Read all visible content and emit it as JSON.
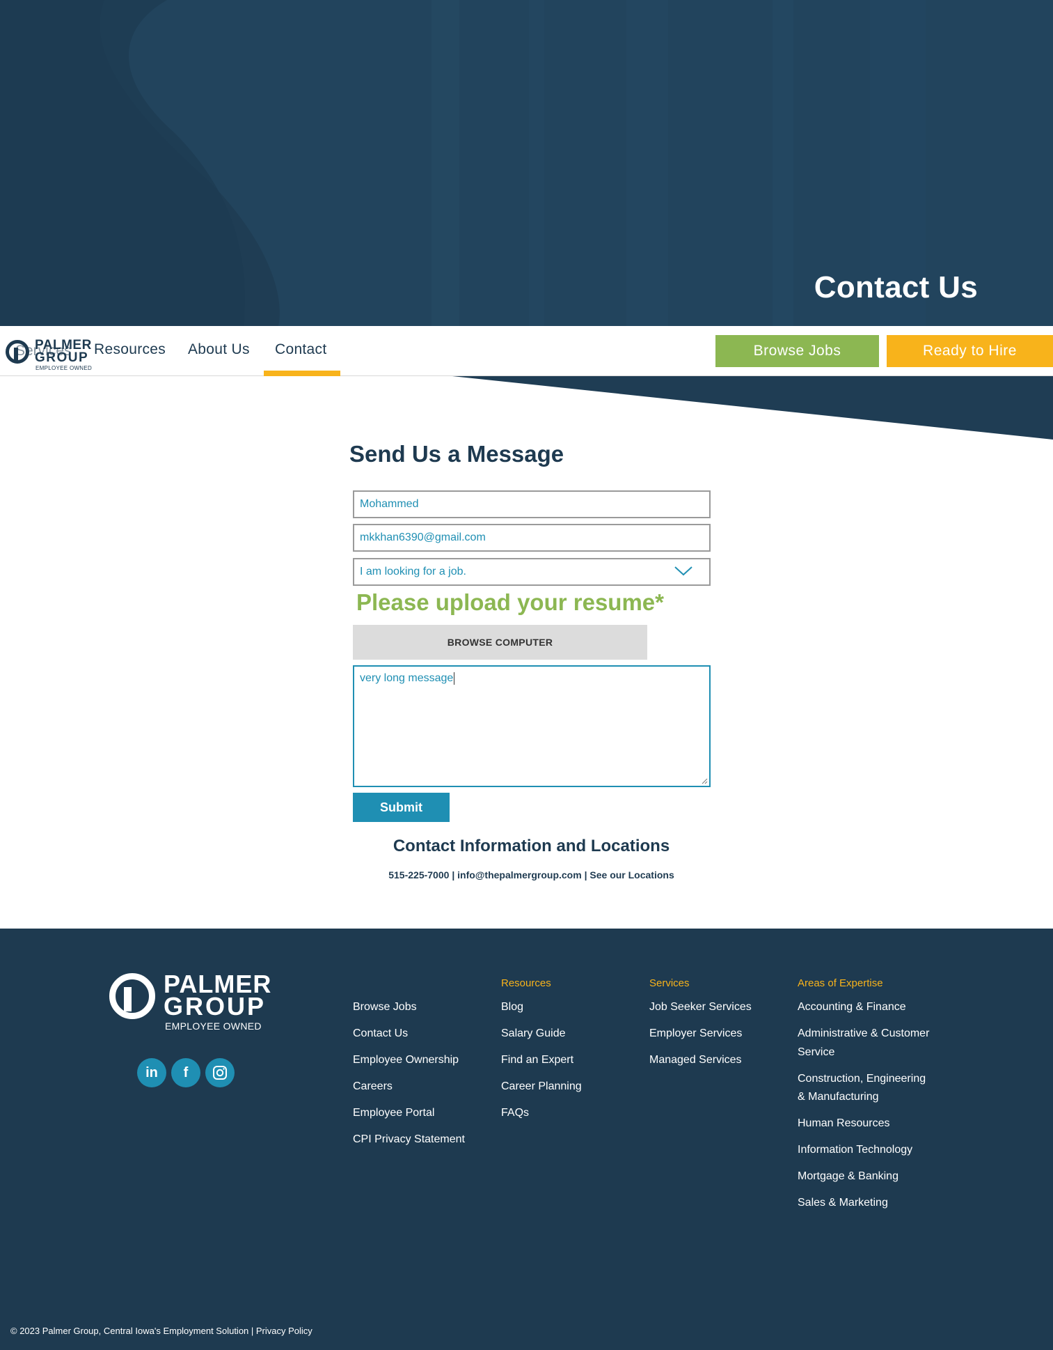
{
  "hero": {
    "title": "Contact Us"
  },
  "nav": {
    "logo": {
      "line1": "PALMER",
      "line2": "GROUP",
      "line3": "EMPLOYEE OWNED"
    },
    "underlay_label": "Services",
    "items": [
      {
        "label": "Resources"
      },
      {
        "label": "About Us"
      },
      {
        "label": "Contact",
        "active": true
      }
    ],
    "browse_jobs": "Browse Jobs",
    "ready_to_hire": "Ready to Hire"
  },
  "form": {
    "title": "Send Us a Message",
    "name_value": "Mohammed",
    "email_value": "mkkhan6390@gmail.com",
    "inquiry_selected": "I am looking for a job.",
    "upload_label": "Please upload your resume*",
    "upload_button": "BROWSE COMPUTER",
    "message_value": "very long message",
    "submit": "Submit"
  },
  "contact": {
    "heading": "Contact Information and Locations",
    "phone": "515-225-7000",
    "email": "info@thepalmergroup.com",
    "locations": "See our Locations",
    "separator": "|"
  },
  "footer": {
    "logo": {
      "line1": "PALMER",
      "line2": "GROUP",
      "line3": "EMPLOYEE OWNED"
    },
    "social": [
      {
        "icon": "linkedin-icon",
        "glyph": "in"
      },
      {
        "icon": "facebook-icon",
        "glyph": "f"
      },
      {
        "icon": "instagram-icon",
        "glyph": ""
      }
    ],
    "col1": {
      "heading": "",
      "links": [
        "Browse Jobs",
        "Contact Us",
        "Employee Ownership",
        "Careers",
        "Employee Portal",
        "CPI Privacy Statement"
      ]
    },
    "col2": {
      "heading": "Resources",
      "links": [
        "Blog",
        "Salary Guide",
        "Find an Expert",
        "Career Planning",
        "FAQs"
      ]
    },
    "col3": {
      "heading": "Services",
      "links": [
        "Job Seeker Services",
        "Employer Services",
        "Managed Services"
      ]
    },
    "col4": {
      "heading": "Areas of Expertise",
      "links": [
        "Accounting & Finance",
        "Administrative & Customer Service",
        "Construction, Engineering & Manufacturing",
        "Human Resources",
        "Information Technology",
        "Mortgage & Banking",
        "Sales & Marketing"
      ]
    },
    "copyright": "© 2023 Palmer Group, Central Iowa's Employment Solution | Privacy Policy"
  },
  "colors": {
    "navy": "#1e3a50",
    "teal": "#1f8fb3",
    "green": "#8cb752",
    "gold": "#f8b31b"
  }
}
